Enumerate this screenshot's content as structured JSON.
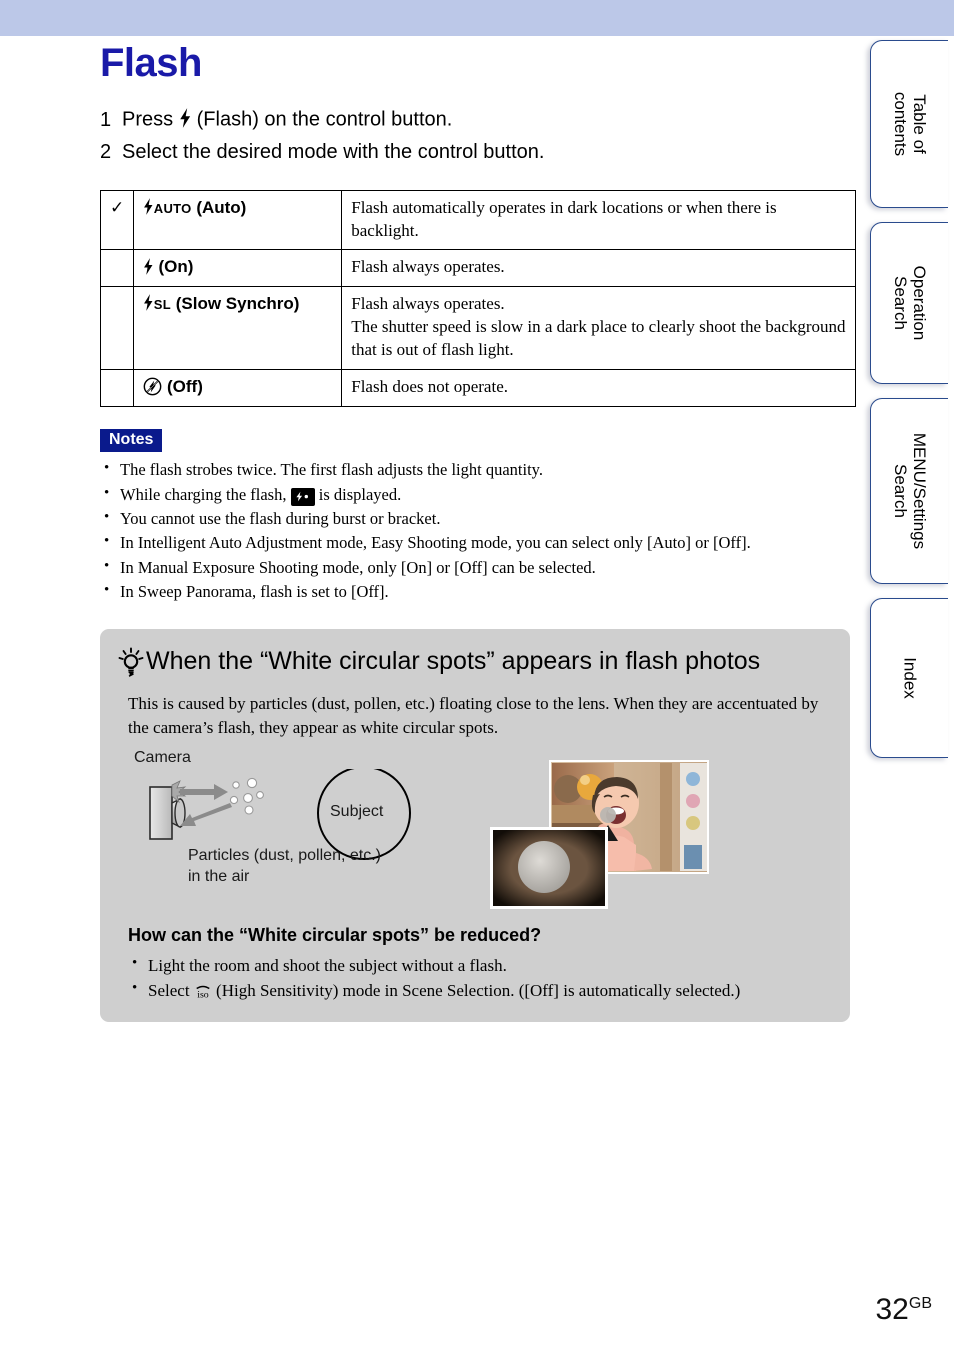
{
  "header": {
    "band_color": "#bcc8e8"
  },
  "page": {
    "title": "Flash",
    "number": "32",
    "number_suffix": "GB",
    "title_color": "#1a1aa8"
  },
  "steps": [
    {
      "num": "1",
      "pre": "Press",
      "icon": "flash-icon",
      "post": "(Flash) on the control button."
    },
    {
      "num": "2",
      "pre": "Select the desired mode with the control button.",
      "icon": "",
      "post": ""
    }
  ],
  "modes_table": {
    "rows": [
      {
        "checked": true,
        "check_glyph": "✓",
        "icon": "flash-auto-icon",
        "icon_text": "AUTO",
        "label": "(Auto)",
        "description": "Flash automatically operates in dark locations or when there is backlight."
      },
      {
        "checked": false,
        "check_glyph": "",
        "icon": "flash-on-icon",
        "icon_text": "",
        "label": "(On)",
        "description": "Flash always operates."
      },
      {
        "checked": false,
        "check_glyph": "",
        "icon": "flash-slow-synchro-icon",
        "icon_text": "SL",
        "label": "(Slow Synchro)",
        "description": "Flash always operates.\nThe shutter speed is slow in a dark place to clearly shoot the background that is out of flash light."
      },
      {
        "checked": false,
        "check_glyph": "",
        "icon": "flash-off-icon",
        "icon_text": "",
        "label": "(Off)",
        "description": "Flash does not operate."
      }
    ]
  },
  "notes": {
    "tag": "Notes",
    "tag_bg": "#0a1a8c",
    "items": [
      {
        "pre": "The flash strobes twice. The first flash adjusts the light quantity.",
        "icon": "",
        "post": ""
      },
      {
        "pre": "While charging the flash,",
        "icon": "flash-charging-icon",
        "post": "is displayed."
      },
      {
        "pre": "You cannot use the flash during burst or bracket.",
        "icon": "",
        "post": ""
      },
      {
        "pre": "In Intelligent Auto Adjustment mode, Easy Shooting mode, you can select only [Auto] or [Off].",
        "icon": "",
        "post": ""
      },
      {
        "pre": "In Manual Exposure Shooting mode, only [On] or [Off] can be selected.",
        "icon": "",
        "post": ""
      },
      {
        "pre": "In Sweep Panorama, flash is set to [Off].",
        "icon": "",
        "post": ""
      }
    ]
  },
  "tip_box": {
    "bg_color": "#cfcfcf",
    "icon": "lightbulb-icon",
    "heading": "When the “White circular spots” appears in flash photos",
    "body": "This is caused by particles (dust, pollen, etc.) floating close to the lens. When they are accentuated by the camera’s flash, they appear as white circular spots.",
    "illustration": {
      "camera_label": "Camera",
      "subject_label": "Subject",
      "particles_label_line1": "Particles (dust, pollen, etc.)",
      "particles_label_line2": "in the air"
    },
    "sub_heading": "How can the “White circular spots” be reduced?",
    "tips": [
      {
        "pre": "Light the room and shoot the subject without a flash.",
        "icon": "",
        "post": ""
      },
      {
        "pre": "Select",
        "icon": "iso-high-sensitivity-icon",
        "post": "(High Sensitivity) mode in Scene Selection. ([Off] is automatically selected.)"
      }
    ]
  },
  "side_tabs": [
    {
      "label_line1": "Table of",
      "label_line2": "contents"
    },
    {
      "label_line1": "Operation",
      "label_line2": "Search"
    },
    {
      "label_line1": "MENU/Settings",
      "label_line2": "Search"
    },
    {
      "label_line1": "Index",
      "label_line2": ""
    }
  ]
}
